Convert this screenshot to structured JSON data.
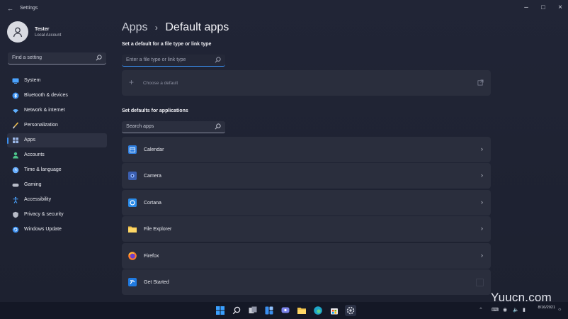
{
  "window": {
    "title": "Settings"
  },
  "account": {
    "name": "Tester",
    "type": "Local Account"
  },
  "search": {
    "placeholder": "Find a setting"
  },
  "sidebar": {
    "items": [
      {
        "label": "System",
        "icon": "monitor-icon",
        "color": "#4aa3ff"
      },
      {
        "label": "Bluetooth & devices",
        "icon": "bluetooth-icon",
        "color": "#3a8ff0"
      },
      {
        "label": "Network & internet",
        "icon": "wifi-icon",
        "color": "#5fb0ff"
      },
      {
        "label": "Personalization",
        "icon": "brush-icon",
        "color": "#f2c14e"
      },
      {
        "label": "Apps",
        "icon": "apps-icon",
        "color": "#9ab6e6",
        "active": true
      },
      {
        "label": "Accounts",
        "icon": "person-icon",
        "color": "#4cc38a"
      },
      {
        "label": "Time & language",
        "icon": "globe-clock-icon",
        "color": "#6ab0ff"
      },
      {
        "label": "Gaming",
        "icon": "gamepad-icon",
        "color": "#b7bbc7"
      },
      {
        "label": "Accessibility",
        "icon": "accessibility-icon",
        "color": "#4aa3ff"
      },
      {
        "label": "Privacy & security",
        "icon": "shield-icon",
        "color": "#b7bbc7"
      },
      {
        "label": "Windows Update",
        "icon": "update-icon",
        "color": "#3a8ff0"
      }
    ]
  },
  "main": {
    "breadcrumb_parent": "Apps",
    "breadcrumb_sep": "›",
    "breadcrumb_current": "Default apps",
    "filetype_section_title": "Set a default for a file type or link type",
    "filetype_placeholder": "Enter a file type or link type",
    "choose_default_label": "Choose a default",
    "apps_section_title": "Set defaults for applications",
    "apps_search_placeholder": "Search apps",
    "apps": [
      {
        "label": "Calendar",
        "icon": "calendar-icon",
        "color": "#2f7fe0"
      },
      {
        "label": "Camera",
        "icon": "camera-icon",
        "color": "#3b5fb0"
      },
      {
        "label": "Cortana",
        "icon": "cortana-icon",
        "color": "#2a8be8"
      },
      {
        "label": "File Explorer",
        "icon": "folder-icon",
        "color": "#f0c24b"
      },
      {
        "label": "Firefox",
        "icon": "firefox-icon",
        "color": "#ff7a2b"
      },
      {
        "label": "Get Started",
        "icon": "get-started-icon",
        "color": "#1f7ae0"
      }
    ]
  },
  "taskbar": {
    "apps": [
      "start-icon",
      "search-icon",
      "task-view-icon",
      "widgets-icon",
      "chat-icon",
      "file-explorer-icon",
      "edge-icon",
      "store-icon",
      "settings-icon"
    ],
    "date": "8/16/2021"
  },
  "watermark": "Yuucn.com"
}
